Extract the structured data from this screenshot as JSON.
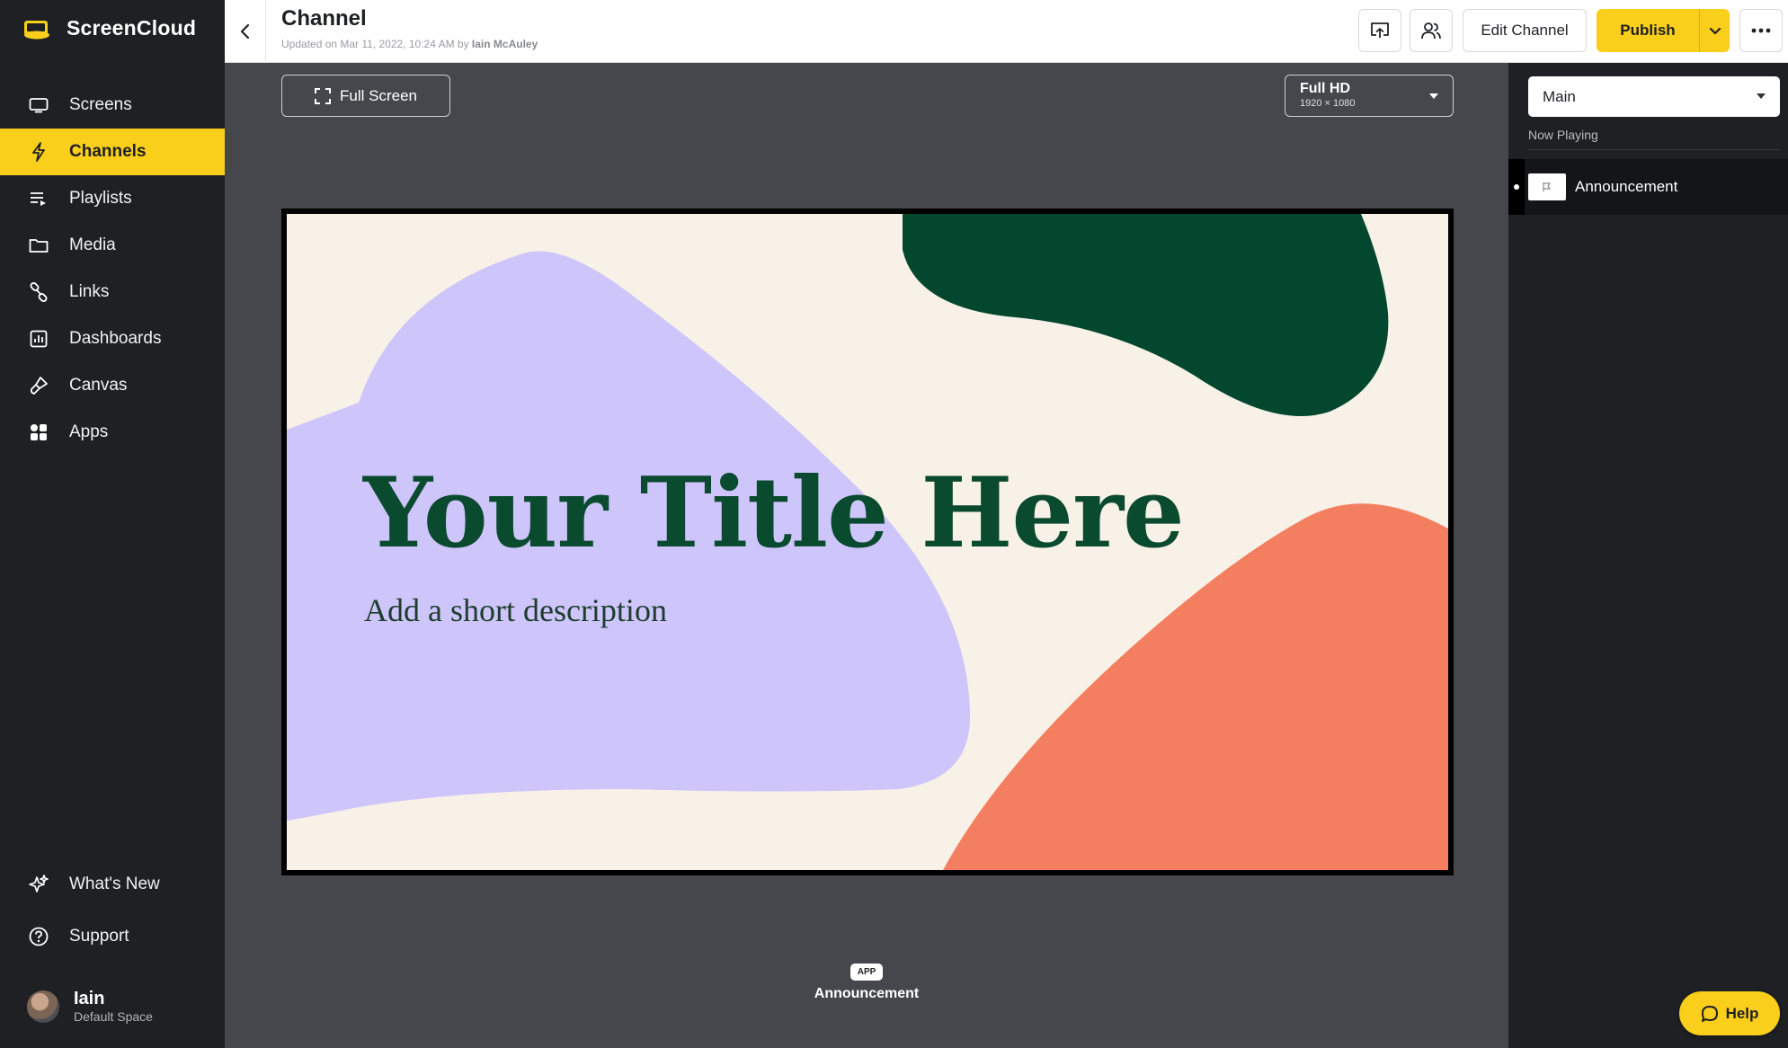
{
  "app": {
    "name": "ScreenCloud"
  },
  "sidebar": {
    "items": [
      {
        "label": "Screens",
        "icon": "screen-icon"
      },
      {
        "label": "Channels",
        "icon": "lightning-icon",
        "active": true
      },
      {
        "label": "Playlists",
        "icon": "playlist-icon"
      },
      {
        "label": "Media",
        "icon": "folder-icon"
      },
      {
        "label": "Links",
        "icon": "link-icon"
      },
      {
        "label": "Dashboards",
        "icon": "dashboard-icon"
      },
      {
        "label": "Canvas",
        "icon": "brush-icon"
      },
      {
        "label": "Apps",
        "icon": "apps-icon"
      }
    ],
    "bottom_items": [
      {
        "label": "What's New",
        "icon": "sparkle-icon"
      },
      {
        "label": "Support",
        "icon": "help-circle-icon"
      }
    ],
    "user": {
      "name": "Iain",
      "space": "Default Space"
    }
  },
  "header": {
    "title": "Channel",
    "updated_prefix": "Updated on Mar 11, 2022, 10:24 AM by ",
    "updated_by": "Iain McAuley",
    "edit_label": "Edit Channel",
    "publish_label": "Publish"
  },
  "preview": {
    "fullscreen_label": "Full Screen",
    "resolution_name": "Full HD",
    "resolution_size": "1920 × 1080",
    "slide_title": "Your Title Here",
    "slide_description": "Add a short description",
    "app_badge": "APP",
    "app_name": "Announcement"
  },
  "right_panel": {
    "zone": "Main",
    "now_playing_label": "Now Playing",
    "now_playing_item": "Announcement"
  },
  "help_label": "Help",
  "colors": {
    "accent": "#f9cf1c",
    "sidebar": "#1f2023",
    "preview_bg": "#46474c",
    "slide_bg": "#f8f1e8",
    "blob_purple": "#cec5fb",
    "blob_green": "#04472f",
    "blob_coral": "#f47f60"
  }
}
